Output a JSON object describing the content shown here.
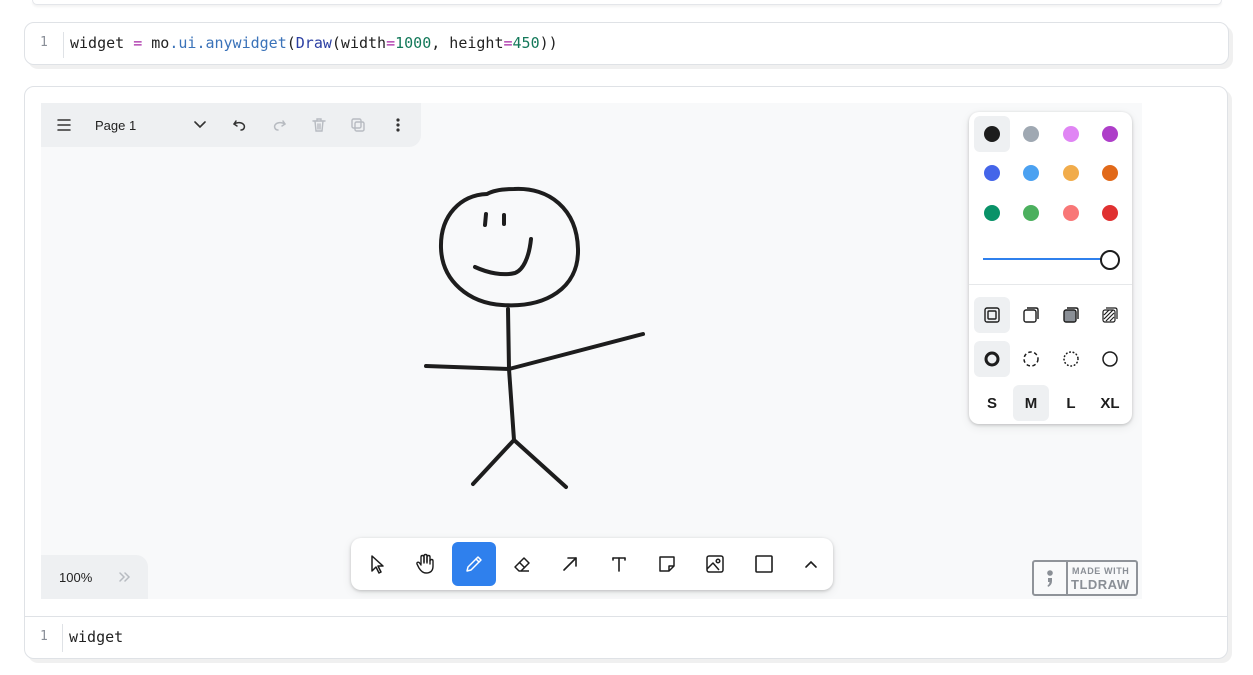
{
  "cells": [
    {
      "line_number": "1",
      "code": {
        "t1": "widget ",
        "op1": "=",
        "t2": " mo",
        "d1": ".",
        "a1": "ui",
        "d2": ".",
        "a2": "anywidget",
        "t3": "(",
        "cls": "Draw",
        "t4": "(width",
        "op2": "=",
        "n1": "1000",
        "t5": ", height",
        "op3": "=",
        "n2": "450",
        "t6": "))"
      }
    },
    {
      "output_line_number": "1",
      "output_code": "widget"
    }
  ],
  "tldraw": {
    "menu": {
      "page_name": "Page 1",
      "icons": [
        "menu-icon",
        "chevron-down-icon",
        "undo-icon",
        "redo-icon",
        "trash-icon",
        "duplicate-icon",
        "more-vertical-icon"
      ]
    },
    "style_panel": {
      "colors": [
        {
          "name": "black",
          "hex": "#1d1d1d",
          "selected": true
        },
        {
          "name": "grey",
          "hex": "#9fa8b2"
        },
        {
          "name": "light-violet",
          "hex": "#e085f4"
        },
        {
          "name": "violet",
          "hex": "#ae3ec9"
        },
        {
          "name": "blue",
          "hex": "#4465e9"
        },
        {
          "name": "light-blue",
          "hex": "#4ba1f1"
        },
        {
          "name": "yellow",
          "hex": "#f1ac4b"
        },
        {
          "name": "orange",
          "hex": "#e16919"
        },
        {
          "name": "green",
          "hex": "#099268"
        },
        {
          "name": "light-green",
          "hex": "#4cb05e"
        },
        {
          "name": "light-red",
          "hex": "#f87777"
        },
        {
          "name": "red",
          "hex": "#e03131"
        }
      ],
      "opacity": 1.0,
      "sizes": [
        "S",
        "M",
        "L",
        "XL"
      ],
      "selected_size": "M"
    },
    "toolbar": {
      "tools": [
        "select-icon",
        "hand-icon",
        "draw-icon",
        "eraser-icon",
        "arrow-icon",
        "text-icon",
        "note-icon",
        "image-icon",
        "rectangle-icon",
        "chevron-up-icon"
      ],
      "active_tool": "draw"
    },
    "zoom": "100%",
    "watermark": {
      "top": "MADE WITH",
      "bottom": "TLDRAW"
    }
  }
}
